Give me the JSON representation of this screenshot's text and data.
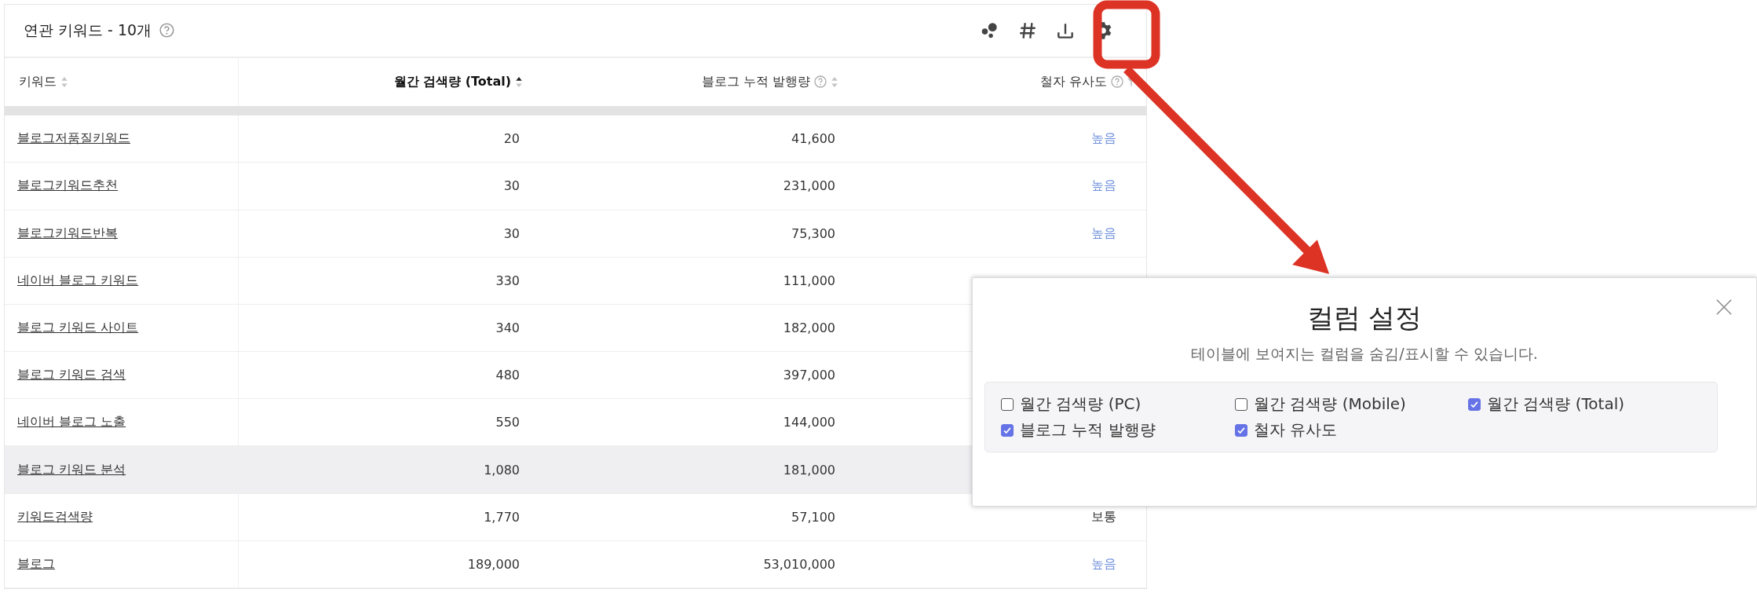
{
  "panel": {
    "title": "연관 키워드 - 10개",
    "title_help": true
  },
  "columns": [
    {
      "label": "키워드",
      "help": false,
      "kind": "sort"
    },
    {
      "label": "월간 검색량 (Total)",
      "help": false,
      "kind": "sorted"
    },
    {
      "label": "블로그 누적 발행량",
      "help": true,
      "kind": "sort"
    },
    {
      "label": "철자 유사도",
      "help": true,
      "kind": "filter"
    }
  ],
  "rows": [
    {
      "keyword": "블로그저품질키워드",
      "total": "20",
      "blog": "41,600",
      "similarity": "높음",
      "color": "#6f8fdc",
      "hovered": false
    },
    {
      "keyword": "블로그키워드추천",
      "total": "30",
      "blog": "231,000",
      "similarity": "높음",
      "color": "#6f8fdc",
      "hovered": false
    },
    {
      "keyword": "블로그키워드반복",
      "total": "30",
      "blog": "75,300",
      "similarity": "높음",
      "color": "#6f8fdc",
      "hovered": false
    },
    {
      "keyword": "네이버 블로그 키워드",
      "total": "330",
      "blog": "111,000",
      "hovered": false
    },
    {
      "keyword": "블로그 키워드 사이트",
      "total": "340",
      "blog": "182,000",
      "hovered": false
    },
    {
      "keyword": "블로그 키워드 검색",
      "total": "480",
      "blog": "397,000",
      "hovered": false
    },
    {
      "keyword": "네이버 블로그 노출",
      "total": "550",
      "blog": "144,000",
      "hovered": false
    },
    {
      "keyword": "블로그 키워드 분석",
      "total": "1,080",
      "blog": "181,000",
      "hovered": true
    },
    {
      "keyword": "키워드검색량",
      "total": "1,770",
      "blog": "57,100",
      "similarity": "보통",
      "color": "#333333",
      "hovered": false
    },
    {
      "keyword": "블로그",
      "total": "189,000",
      "blog": "53,010,000",
      "similarity": "높음",
      "color": "#6f8fdc",
      "hovered": false
    }
  ],
  "dialog": {
    "title": "컬럼 설정",
    "subtitle": "테이블에 보여지는 컬럼을 숨김/표시할 수 있습니다.",
    "options": [
      {
        "label": "월간 검색량 (PC)",
        "checked": false
      },
      {
        "label": "월간 검색량 (Mobile)",
        "checked": false
      },
      {
        "label": "월간 검색량 (Total)",
        "checked": true
      },
      {
        "label": "블로그 누적 발행량",
        "checked": true
      },
      {
        "label": "철자 유사도",
        "checked": true
      }
    ]
  }
}
